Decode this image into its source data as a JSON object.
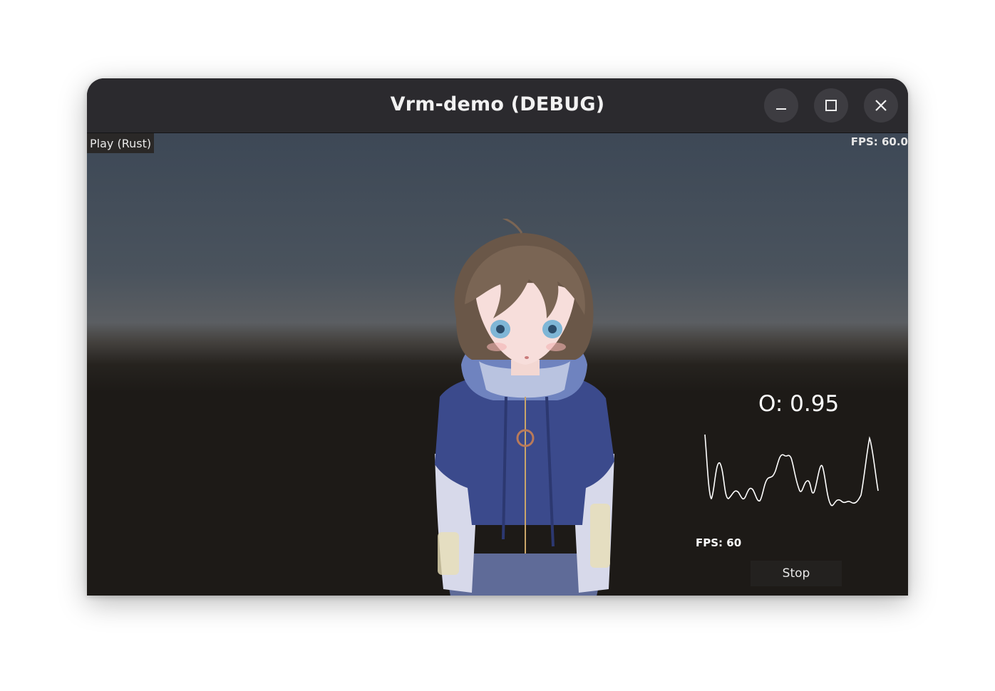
{
  "window": {
    "title": "Vrm-demo (DEBUG)",
    "controls": {
      "minimize": "minimize-icon",
      "maximize": "maximize-icon",
      "close": "close-icon"
    }
  },
  "viewport": {
    "play_label": "Play (Rust)",
    "fps_top": "FPS: 60.0",
    "vowel_readout": "O: 0.95",
    "fps_bottom": "FPS: 60",
    "stop_label": "Stop"
  },
  "colors": {
    "titlebar": "#2b2a2e",
    "button_bg": "#3d3c41",
    "sky_top": "#3d4856",
    "floor": "#1d1a17",
    "hoodie": "#3b4a8c"
  }
}
